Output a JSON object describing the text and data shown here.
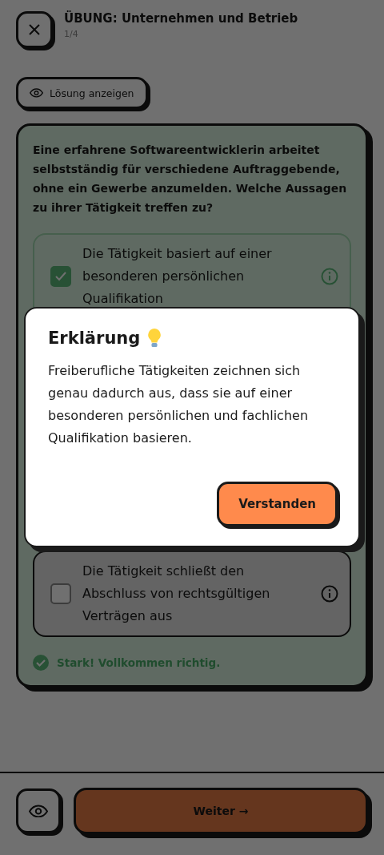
{
  "header": {
    "title": "ÜBUNG: Unternehmen und Betrieb",
    "progress": "1/4"
  },
  "solution_button": {
    "label": "Lösung anzeigen"
  },
  "question": {
    "text": "Eine erfahrene Softwareentwicklerin arbeitet selbstständig für verschiedene Auftraggebende, ohne ein Gewerbe anzumelden. Welche Aussagen zu ihrer Tätigkeit treffen zu?",
    "options": [
      {
        "text": "Die Tätigkeit basiert auf einer besonderen persönlichen Qualifikation",
        "checked": true
      },
      {
        "text": "Die Tätigkeit schließt den Abschluss von rechtsgültigen Verträgen aus",
        "checked": false
      }
    ],
    "feedback": "Stark! Vollkommen richtig."
  },
  "footer": {
    "next_label": "Weiter →"
  },
  "dialog": {
    "title": "Erklärung",
    "body": "Freiberufliche Tätigkeiten zeichnen sich genau dadurch aus, dass sie auf einer besonderen persönlichen und fachlichen Qualifikation basieren.",
    "button": "Verstanden"
  }
}
